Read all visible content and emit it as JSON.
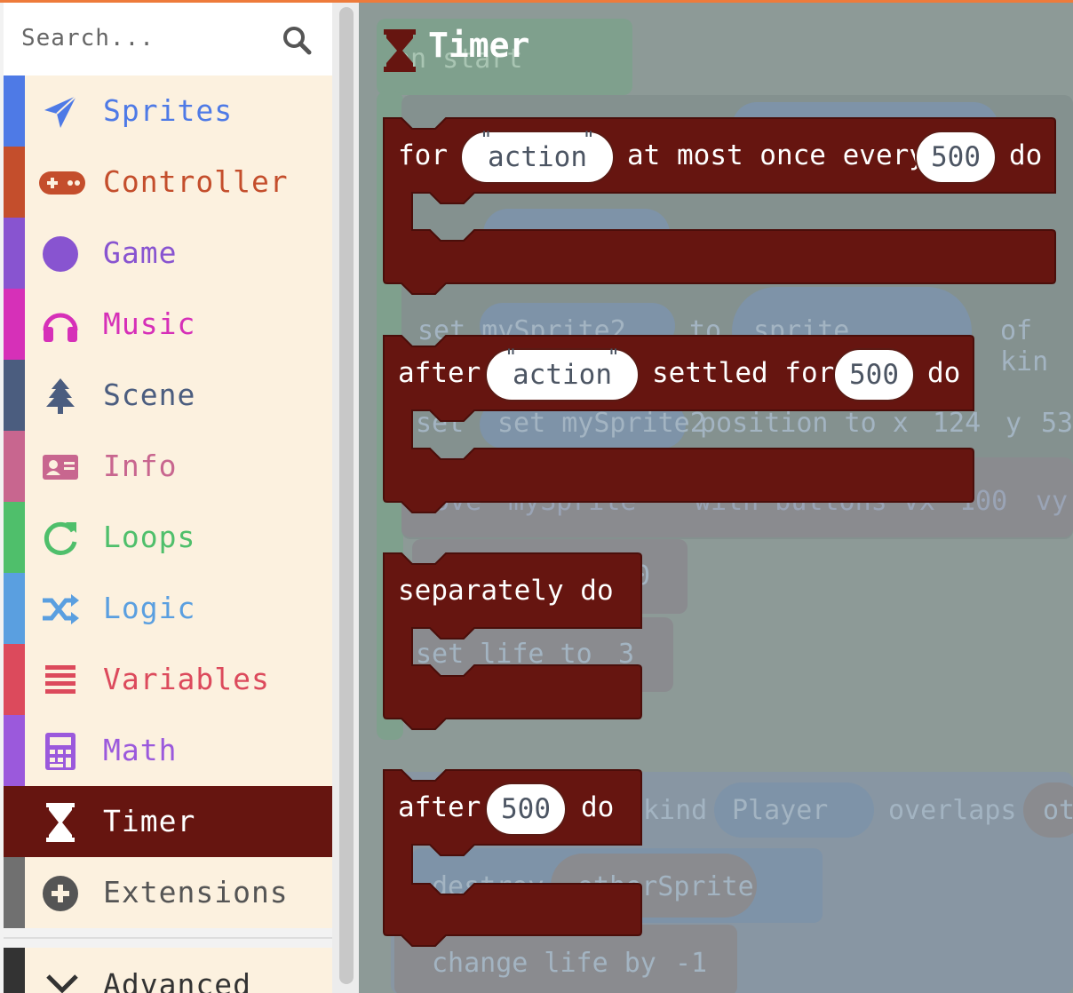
{
  "search": {
    "placeholder": "Search..."
  },
  "categories": [
    {
      "label": "Sprites",
      "color": "#4e7ae6",
      "icon": "paper-plane-icon"
    },
    {
      "label": "Controller",
      "color": "#c44e2c",
      "icon": "gamepad-icon"
    },
    {
      "label": "Game",
      "color": "#8854d0",
      "icon": "circle-icon"
    },
    {
      "label": "Music",
      "color": "#d630b8",
      "icon": "headphones-icon"
    },
    {
      "label": "Scene",
      "color": "#4b5d7f",
      "icon": "tree-icon"
    },
    {
      "label": "Info",
      "color": "#c8668f",
      "icon": "id-card-icon"
    },
    {
      "label": "Loops",
      "color": "#4fbf6b",
      "icon": "refresh-icon"
    },
    {
      "label": "Logic",
      "color": "#5a9fe0",
      "icon": "shuffle-icon"
    },
    {
      "label": "Variables",
      "color": "#dc4a5c",
      "icon": "list-icon"
    },
    {
      "label": "Math",
      "color": "#9b59dc",
      "icon": "calculator-icon"
    },
    {
      "label": "Timer",
      "color": "#661510",
      "icon": "hourglass-icon",
      "selected": true
    },
    {
      "label": "Extensions",
      "color": "#707070",
      "icon": "plus-circle-icon"
    }
  ],
  "advanced": {
    "label": "Advanced"
  },
  "flyout": {
    "title": "Timer",
    "blocks": {
      "throttle": {
        "w1": "for",
        "arg": "action",
        "w2": "at most once every",
        "num": "500",
        "w3": "do"
      },
      "debounce": {
        "w1": "after",
        "arg": "action",
        "w2": "settled for",
        "num": "500",
        "w3": "do"
      },
      "background": {
        "w1": "separately do"
      },
      "after": {
        "w1": "after",
        "num": "500",
        "w2": "do"
      }
    }
  },
  "workspace_ghost": {
    "on_start": "on start",
    "set_mysprite2": "set mySprite2",
    "to": "to",
    "sprite": "sprite",
    "of_kind": "of kin",
    "set": "set",
    "position_to_x": "position to x",
    "pos_x": "124",
    "y": "y",
    "pos_y": "53",
    "move": "move",
    "mysprite": "mySprite",
    "with_buttons_vx": "with buttons vx",
    "vx": "100",
    "vy": "vy",
    "zero": "0",
    "set_life_to": "set life to",
    "life": "3",
    "kind": "kind",
    "player": "Player",
    "overlaps": "overlaps",
    "ot": "ot",
    "destroy": "destroy",
    "othersprite": "otherSprite",
    "change_life_by": "change life by",
    "delta": "-1"
  },
  "colors": {
    "timer": "#661510",
    "toolbox_bg": "#fcf1df",
    "accent": "#ee7b3b"
  }
}
